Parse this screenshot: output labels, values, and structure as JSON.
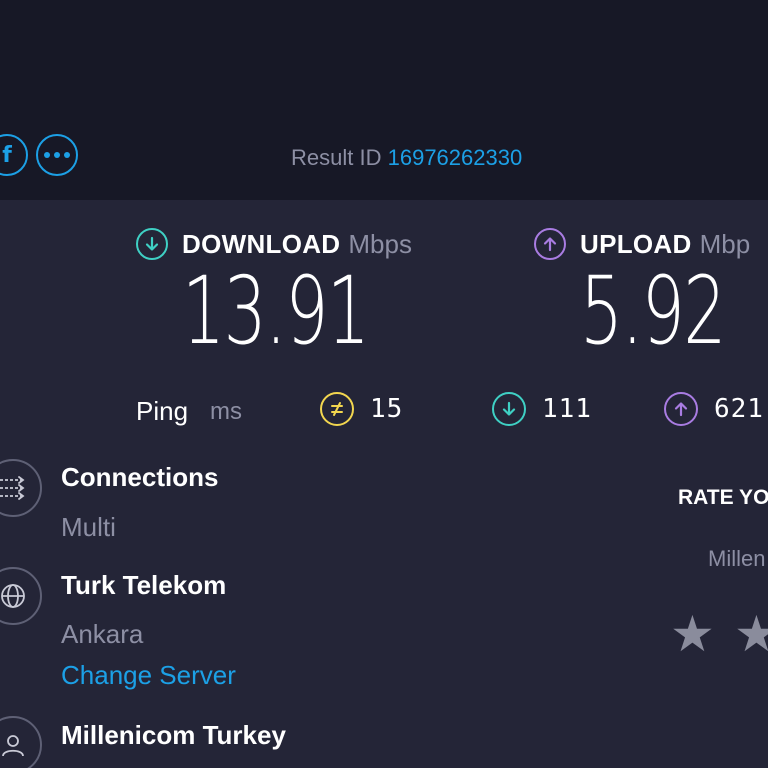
{
  "share": {
    "facebook_icon": "facebook-icon",
    "more_icon": "more-options-icon"
  },
  "result": {
    "label": "Result ID",
    "id": "16976262330"
  },
  "download": {
    "label": "DOWNLOAD",
    "unit": "Mbps",
    "value": "13.91",
    "color": "#3fd0c4"
  },
  "upload": {
    "label": "UPLOAD",
    "unit": "Mbp",
    "value": "5.92",
    "color": "#a97ce2"
  },
  "ping": {
    "label": "Ping",
    "unit": "ms",
    "idle": "15",
    "download": "111",
    "upload": "621",
    "idle_color": "#f2d64f"
  },
  "connections": {
    "title": "Connections",
    "value": "Multi"
  },
  "server": {
    "name": "Turk Telekom",
    "location": "Ankara",
    "change_label": "Change Server"
  },
  "isp": {
    "name": "Millenicom Turkey"
  },
  "rating": {
    "title": "RATE YO",
    "isp_partial": "Millen",
    "stars_visible": 2
  },
  "colors": {
    "background": "#242537",
    "header_band": "#171826",
    "accent_blue": "#1ca0e6",
    "muted_text": "#8d8fa4"
  }
}
